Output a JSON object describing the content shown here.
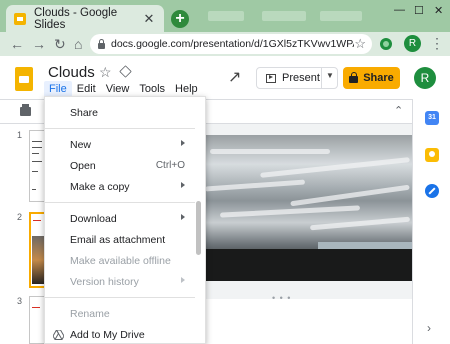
{
  "browser": {
    "tab_title": "Clouds - Google Slides",
    "tab_close": "✕",
    "new_tab": "+",
    "url": "docs.google.com/presentation/d/1GXl5zTKVwv1WPA...",
    "profile_initial": "R",
    "win_min": "—",
    "win_max": "☐",
    "win_close": "✕"
  },
  "header": {
    "title": "Clouds",
    "menu": [
      "File",
      "Edit",
      "View",
      "Tools",
      "Help"
    ],
    "present_label": "Present",
    "share_label": "Share",
    "avatar_initial": "R"
  },
  "filmstrip": {
    "slide_numbers": [
      "1",
      "2",
      "3"
    ]
  },
  "file_menu": {
    "items": [
      {
        "label": "Share",
        "shortcut": "",
        "submenu": false,
        "disabled": false
      },
      {
        "label": "New",
        "shortcut": "",
        "submenu": true,
        "disabled": false
      },
      {
        "label": "Open",
        "shortcut": "Ctrl+O",
        "submenu": false,
        "disabled": false
      },
      {
        "label": "Make a copy",
        "shortcut": "",
        "submenu": true,
        "disabled": false
      },
      {
        "label": "Download",
        "shortcut": "",
        "submenu": true,
        "disabled": false
      },
      {
        "label": "Email as attachment",
        "shortcut": "",
        "submenu": false,
        "disabled": false
      },
      {
        "label": "Make available offline",
        "shortcut": "",
        "submenu": false,
        "disabled": true
      },
      {
        "label": "Version history",
        "shortcut": "",
        "submenu": true,
        "disabled": true
      },
      {
        "label": "Rename",
        "shortcut": "",
        "submenu": false,
        "disabled": true
      },
      {
        "label": "Add to My Drive",
        "shortcut": "",
        "submenu": false,
        "disabled": false
      }
    ]
  },
  "side_panel": {
    "calendar_text": "31"
  },
  "colors": {
    "accent": "#1a73e8",
    "share_button": "#f9ab00",
    "chrome_frame": "#9fc9a4"
  }
}
